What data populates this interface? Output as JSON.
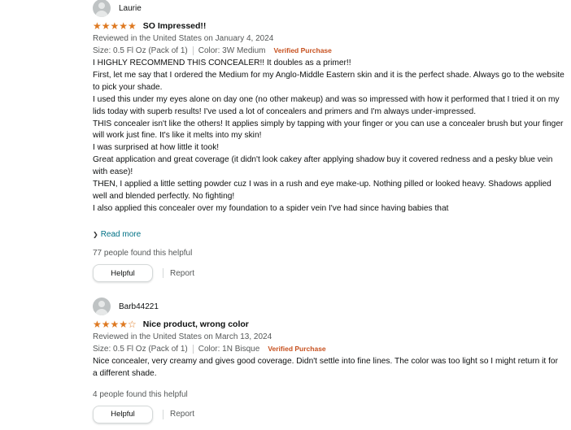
{
  "colors": {
    "star": "#de7921",
    "verified": "#C7511F",
    "link": "#007185"
  },
  "reviews": [
    {
      "reviewer": "Laurie",
      "stars": "★★★★★",
      "stars_empty": "",
      "rating": 5,
      "title": "SO Impressed!!",
      "date_line": "Reviewed in the United States on January 4, 2024",
      "size": "Size: 0.5 Fl Oz (Pack of 1)",
      "color": "Color: 3W Medium",
      "verified": "Verified Purchase",
      "body": [
        "I HIGHLY RECOMMEND THIS CONCEALER!! It doubles as a primer!!",
        "First, let me say that I ordered the Medium for my Anglo-Middle Eastern skin and it is the perfect shade. Always go to the website to pick your shade.",
        "I used this under my eyes alone on day one (no other makeup) and was so impressed with how it performed that I tried it on my lids today with superb results! I've used a lot of concealers and primers and I'm always under-impressed.",
        "THIS concealer isn't like the others! It applies simply by tapping with your finger or you can use a concealer brush but your finger will work just fine. It's like it melts into my skin!",
        "I was surprised at how little it took!",
        "Great application and great coverage (it didn't look cakey after applying shadow buy it covered redness and a pesky blue vein with ease)!",
        "THEN, I applied a little setting powder cuz I was in a rush and eye make-up. Nothing pilled or looked heavy. Shadows applied well and blended perfectly. No fighting!",
        "I also applied this concealer over my foundation to a spider vein I've had since having babies that"
      ],
      "read_more": "Read more",
      "helpful_count": "77 people found this helpful",
      "helpful_button": "Helpful",
      "report": "Report"
    },
    {
      "reviewer": "Barb44221",
      "stars": "★★★★",
      "stars_empty": "☆",
      "rating": 4,
      "title": "Nice product, wrong color",
      "date_line": "Reviewed in the United States on March 13, 2024",
      "size": "Size: 0.5 Fl Oz (Pack of 1)",
      "color": "Color: 1N Bisque",
      "verified": "Verified Purchase",
      "body": [
        "Nice concealer, very creamy and gives good coverage. Didn't settle into fine lines. The color was too light so I might return it for a different shade."
      ],
      "helpful_count": "4 people found this helpful",
      "helpful_button": "Helpful",
      "report": "Report"
    }
  ]
}
